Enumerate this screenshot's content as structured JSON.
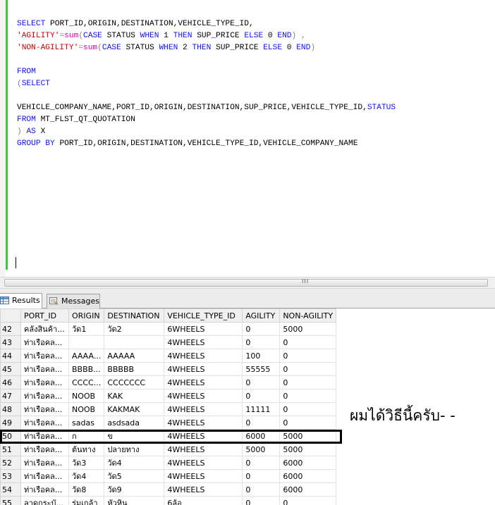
{
  "editor": {
    "lines": [
      [
        {
          "t": "SELECT",
          "c": "kw"
        },
        {
          "t": " PORT_ID,ORIGIN,DESTINATION,VEHICLE_TYPE_ID,",
          "c": ""
        }
      ],
      [
        {
          "t": "'AGILITY'",
          "c": "str"
        },
        {
          "t": "=",
          "c": "gry"
        },
        {
          "t": "sum",
          "c": "fn"
        },
        {
          "t": "(",
          "c": "gry"
        },
        {
          "t": "CASE",
          "c": "kw"
        },
        {
          "t": " STATUS ",
          "c": ""
        },
        {
          "t": "WHEN",
          "c": "kw"
        },
        {
          "t": " 1 ",
          "c": ""
        },
        {
          "t": "THEN",
          "c": "kw"
        },
        {
          "t": " SUP_PRICE ",
          "c": ""
        },
        {
          "t": "ELSE",
          "c": "kw"
        },
        {
          "t": " 0 ",
          "c": ""
        },
        {
          "t": "END",
          "c": "kw"
        },
        {
          "t": ")",
          "c": "gry"
        },
        {
          "t": " ,",
          "c": "gry"
        }
      ],
      [
        {
          "t": "'NON-AGILITY'",
          "c": "str"
        },
        {
          "t": "=",
          "c": "gry"
        },
        {
          "t": "sum",
          "c": "fn"
        },
        {
          "t": "(",
          "c": "gry"
        },
        {
          "t": "CASE",
          "c": "kw"
        },
        {
          "t": " STATUS ",
          "c": ""
        },
        {
          "t": "WHEN",
          "c": "kw"
        },
        {
          "t": " 2 ",
          "c": ""
        },
        {
          "t": "THEN",
          "c": "kw"
        },
        {
          "t": " SUP_PRICE ",
          "c": ""
        },
        {
          "t": "ELSE",
          "c": "kw"
        },
        {
          "t": " 0 ",
          "c": ""
        },
        {
          "t": "END",
          "c": "kw"
        },
        {
          "t": ")",
          "c": "gry"
        }
      ],
      [],
      [
        {
          "t": "FROM",
          "c": "kw"
        }
      ],
      [
        {
          "t": "(",
          "c": "gry"
        },
        {
          "t": "SELECT",
          "c": "kw"
        }
      ],
      [],
      [
        {
          "t": "VEHICLE_COMPANY_NAME,PORT_ID,ORIGIN,DESTINATION,SUP_PRICE,VEHICLE_TYPE_ID,",
          "c": ""
        },
        {
          "t": "STATUS",
          "c": "kw"
        }
      ],
      [
        {
          "t": "FROM",
          "c": "kw"
        },
        {
          "t": " MT_FLST_QT_QUOTATION",
          "c": ""
        }
      ],
      [
        {
          "t": ")",
          "c": "gry"
        },
        {
          "t": " ",
          "c": ""
        },
        {
          "t": "AS",
          "c": "kw"
        },
        {
          "t": " X",
          "c": ""
        }
      ],
      [
        {
          "t": "GROUP",
          "c": "kw"
        },
        {
          "t": " ",
          "c": ""
        },
        {
          "t": "BY",
          "c": "kw"
        },
        {
          "t": " PORT_ID,ORIGIN,DESTINATION,VEHICLE_TYPE_ID,VEHICLE_COMPANY_NAME",
          "c": ""
        }
      ]
    ]
  },
  "scrollbar": {
    "grip": "III"
  },
  "tabs": {
    "results": "Results",
    "messages": "Messages"
  },
  "grid": {
    "columns": [
      "",
      "PORT_ID",
      "ORIGIN",
      "DESTINATION",
      "VEHICLE_TYPE_ID",
      "AGILITY",
      "NON-AGILITY"
    ],
    "rows": [
      [
        "42",
        "คลังสินค้า...",
        "วัด1",
        "วัด2",
        "6WHEELS",
        "0",
        "5000"
      ],
      [
        "43",
        "ท่าเรือคล...",
        "",
        "",
        "4WHEELS",
        "0",
        "0"
      ],
      [
        "44",
        "ท่าเรือคล...",
        "AAAA...",
        "AAAAA",
        "4WHEELS",
        "100",
        "0"
      ],
      [
        "45",
        "ท่าเรือคล...",
        "BBBB...",
        "BBBBB",
        "4WHEELS",
        "55555",
        "0"
      ],
      [
        "46",
        "ท่าเรือคล...",
        "CCCC...",
        "CCCCCCC",
        "4WHEELS",
        "0",
        "0"
      ],
      [
        "47",
        "ท่าเรือคล...",
        "NOOB",
        "KAK",
        "4WHEELS",
        "0",
        "0"
      ],
      [
        "48",
        "ท่าเรือคล...",
        "NOOB",
        "KAKMAK",
        "4WHEELS",
        "11111",
        "0"
      ],
      [
        "49",
        "ท่าเรือคล...",
        "sadas",
        "asdsada",
        "4WHEELS",
        "0",
        "0"
      ],
      [
        "50",
        "ท่าเรือคล...",
        "ก",
        "ข",
        "4WHEELS",
        "6000",
        "5000"
      ],
      [
        "51",
        "ท่าเรือคล...",
        "ต้นทาง",
        "ปลายทาง",
        "4WHEELS",
        "5000",
        "5000"
      ],
      [
        "52",
        "ท่าเรือคล...",
        "วัด3",
        "วัด4",
        "4WHEELS",
        "0",
        "6000"
      ],
      [
        "53",
        "ท่าเรือคล...",
        "วัด4",
        "วัด5",
        "4WHEELS",
        "0",
        "6000"
      ],
      [
        "54",
        "ท่าเรือคล...",
        "วัด8",
        "วัด9",
        "4WHEELS",
        "0",
        "6000"
      ],
      [
        "55",
        "ลาดกระบั...",
        "ร่มเกล้า",
        "หัวหิน",
        "6ล้อ",
        "0",
        "0"
      ]
    ]
  },
  "comment": "ผมได้วิธีนี้ครับ- -"
}
